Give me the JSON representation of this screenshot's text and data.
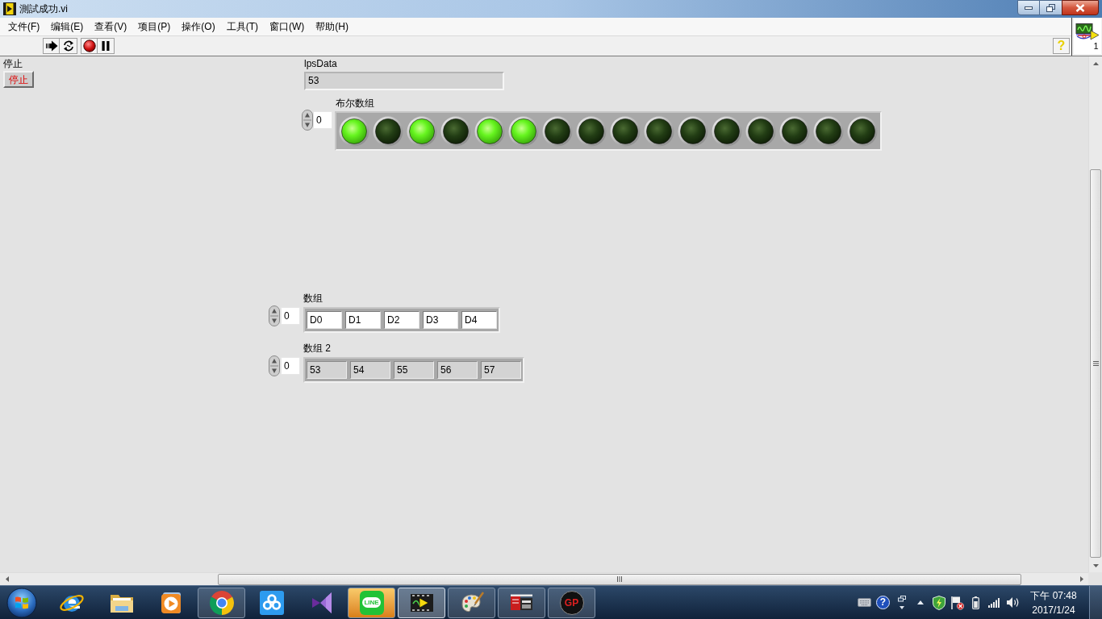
{
  "window": {
    "title": "測試成功.vi"
  },
  "menu": [
    "文件(F)",
    "编辑(E)",
    "查看(V)",
    "项目(P)",
    "操作(O)",
    "工具(T)",
    "窗口(W)",
    "帮助(H)"
  ],
  "toolbar": {
    "help": "?"
  },
  "vi_icon": {
    "number": "1"
  },
  "front_panel": {
    "stop": {
      "label": "停止",
      "text": "停止"
    },
    "lpsdata": {
      "label": "lpsData",
      "value": "53"
    },
    "bool_array": {
      "label": "布尔数组",
      "index": "0",
      "leds": [
        {
          "on": true
        },
        {
          "on": false
        },
        {
          "on": true
        },
        {
          "on": false
        },
        {
          "on": true
        },
        {
          "on": true
        },
        {
          "on": false
        },
        {
          "on": false
        },
        {
          "on": false
        },
        {
          "on": false
        },
        {
          "on": false
        },
        {
          "on": false
        },
        {
          "on": false
        },
        {
          "on": false
        },
        {
          "on": false
        },
        {
          "on": false
        }
      ]
    },
    "arrays": [
      {
        "kind": "control",
        "label": "数组",
        "index": "0",
        "elements": [
          "D0",
          "D1",
          "D2",
          "D3",
          "D4"
        ]
      },
      {
        "kind": "indicator",
        "label": "数组 2",
        "index": "0",
        "elements": [
          "53",
          "54",
          "55",
          "56",
          "57"
        ]
      }
    ]
  },
  "taskbar": {
    "apps": [
      {
        "kind": "e_logo",
        "open": false,
        "active": false,
        "attention": false
      },
      {
        "kind": "folder",
        "open": false,
        "active": false,
        "attention": false
      },
      {
        "kind": "media",
        "open": false,
        "active": false,
        "attention": false
      },
      {
        "kind": "ring_logo",
        "open": true,
        "active": false,
        "attention": false
      },
      {
        "kind": "cloud",
        "open": false,
        "active": false,
        "attention": false
      },
      {
        "kind": "bowtie",
        "open": false,
        "active": false,
        "attention": false
      },
      {
        "kind": "chat",
        "text": "LINE",
        "open": true,
        "active": false,
        "attention": true
      },
      {
        "kind": "film",
        "open": true,
        "active": true,
        "attention": false
      },
      {
        "kind": "palette",
        "open": true,
        "active": false,
        "attention": false
      },
      {
        "kind": "device",
        "open": true,
        "active": false,
        "attention": false
      },
      {
        "kind": "gp_logo",
        "text": "GP",
        "open": true,
        "active": false,
        "attention": false
      }
    ],
    "tray": {
      "help": "?"
    },
    "clock": {
      "time": "下午 07:48",
      "date": "2017/1/24"
    }
  }
}
